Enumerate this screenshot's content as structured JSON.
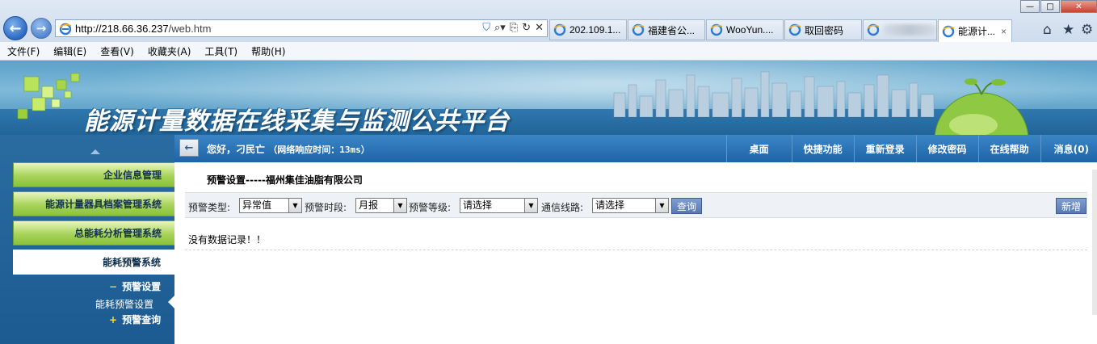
{
  "browser": {
    "url_host": "http://218.66.36.237",
    "url_path": "/web.htm",
    "tabs": [
      {
        "label": "202.109.1...",
        "active": false
      },
      {
        "label": "福建省公...",
        "active": false
      },
      {
        "label": "WooYun....",
        "active": false
      },
      {
        "label": "取回密码",
        "active": false
      },
      {
        "label": "",
        "active": false,
        "redacted": true
      },
      {
        "label": "能源计...",
        "active": true
      }
    ],
    "tab_close": "×",
    "menu": [
      "文件(F)",
      "编辑(E)",
      "查看(V)",
      "收藏夹(A)",
      "工具(T)",
      "帮助(H)"
    ]
  },
  "banner": {
    "title": "能源计量数据在线采集与监测公共平台"
  },
  "statusbar": {
    "toggle": "←",
    "greeting": "您好，刁民亡",
    "response_time": "（网络响应时间：13ms）",
    "nav": [
      "桌面",
      "快捷功能",
      "重新登录",
      "修改密码",
      "在线帮助",
      "消息(0)"
    ]
  },
  "sidebar": {
    "items": [
      {
        "label": "企业信息管理",
        "active": false
      },
      {
        "label": "能源计量器具档案管理系统",
        "active": false
      },
      {
        "label": "总能耗分析管理系统",
        "active": false
      },
      {
        "label": "能耗预警系统",
        "active": true
      }
    ],
    "sub_expanded": {
      "sign": "−",
      "label": "预警设置"
    },
    "sub_leaf": "能耗预警设置",
    "sub_collapsed": {
      "sign": "+",
      "label": "预警查询"
    }
  },
  "content": {
    "title": "预警设置-----福州集佳油脂有限公司",
    "filters": {
      "type_label": "预警类型:",
      "type_value": "异常值",
      "period_label": "预警时段:",
      "period_value": "月报",
      "level_label": "预警等级:",
      "level_value": "请选择",
      "line_label": "通信线路:",
      "line_value": "请选择",
      "query_button": "查询",
      "add_button": "新增"
    },
    "empty_message": "没有数据记录！！"
  },
  "colors": {
    "status_blue": "#1e64a6",
    "sidebar_blue": "#1c5b91",
    "menu_green": "#a8d35a",
    "button_blue": "#5878b3"
  }
}
